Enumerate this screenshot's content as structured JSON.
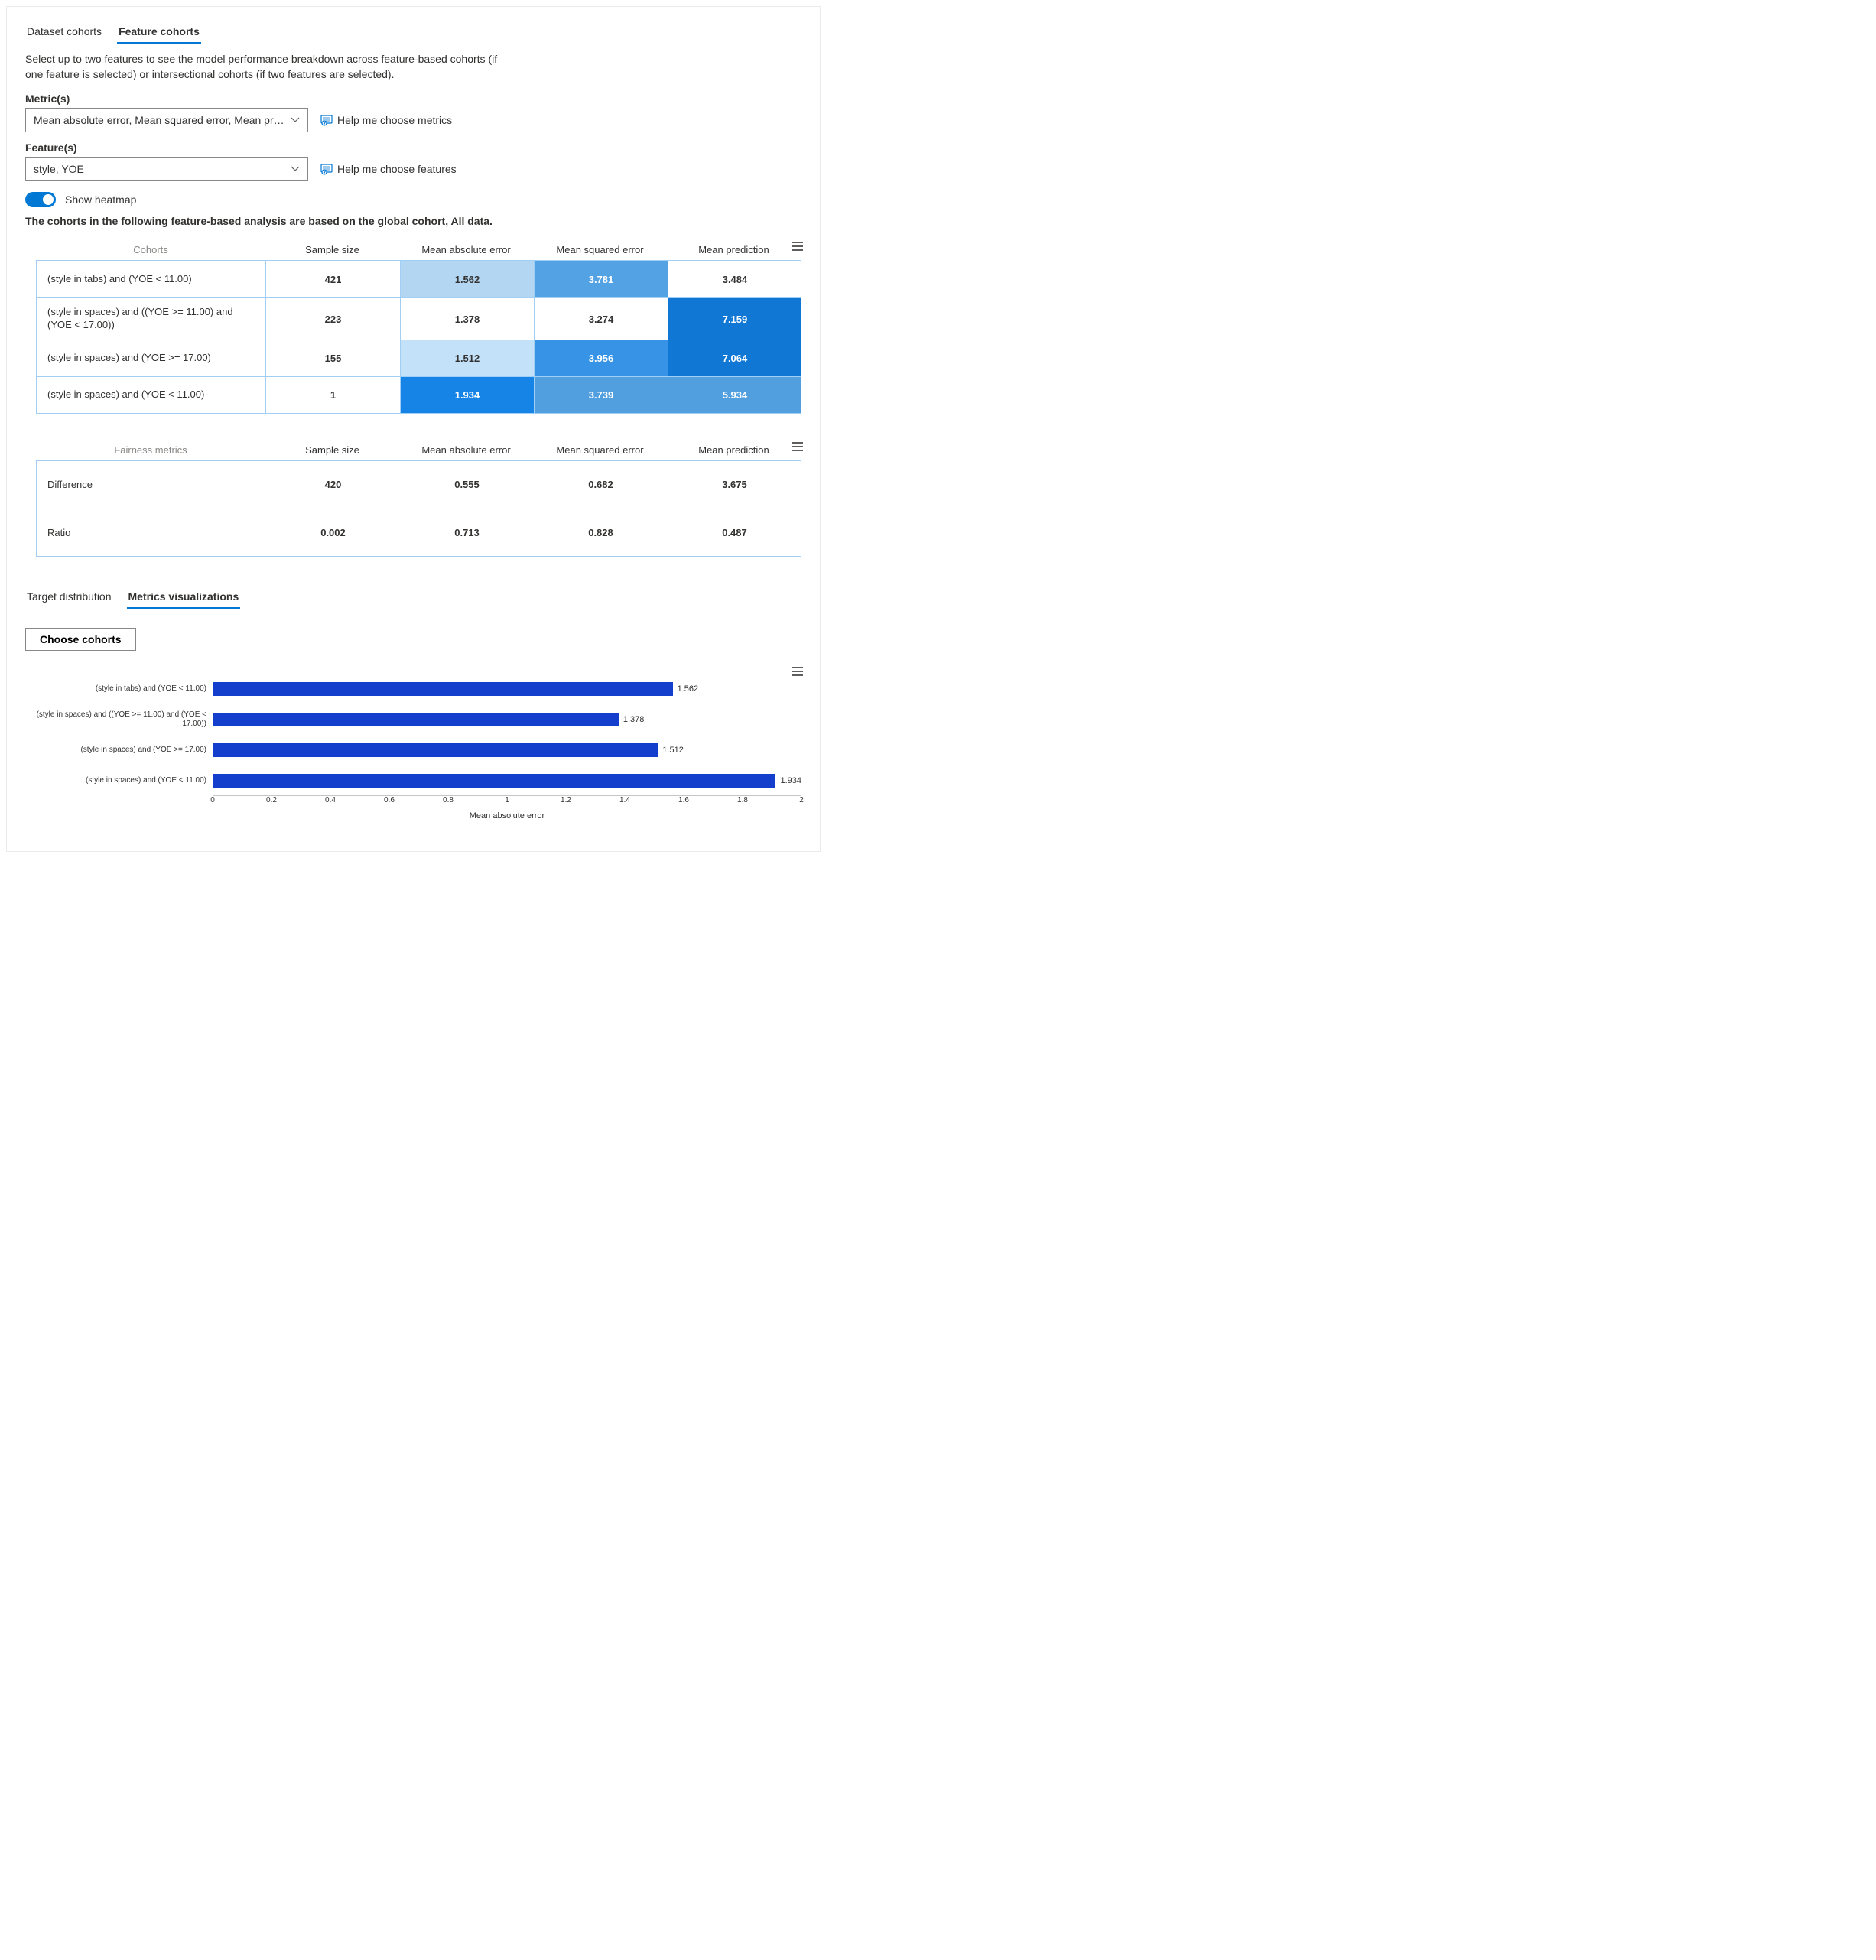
{
  "topTabs": [
    "Dataset cohorts",
    "Feature cohorts"
  ],
  "topTabActive": 1,
  "description": "Select up to two features to see the model performance breakdown across feature-based cohorts (if one feature is selected) or intersectional cohorts (if two features are selected).",
  "metrics": {
    "label": "Metric(s)",
    "value": "Mean absolute error, Mean squared error, Mean predicti...",
    "help": "Help me choose metrics"
  },
  "features": {
    "label": "Feature(s)",
    "value": "style, YOE",
    "help": "Help me choose features"
  },
  "toggle": {
    "label": "Show heatmap",
    "on": true
  },
  "note": "The cohorts in the following feature-based analysis are based on the global cohort, All data.",
  "cohortsTable": {
    "headers": {
      "label": "Cohorts",
      "cols": [
        "Sample size",
        "Mean absolute error",
        "Mean squared error",
        "Mean prediction"
      ]
    },
    "rows": [
      {
        "label": "(style in tabs) and (YOE < 11.00)",
        "cells": [
          {
            "v": "421",
            "shade": "shade-0"
          },
          {
            "v": "1.562",
            "shade": "shade-2"
          },
          {
            "v": "3.781",
            "shade": "shade-3"
          },
          {
            "v": "3.484",
            "shade": "shade-0"
          }
        ]
      },
      {
        "label": "(style in spaces) and ((YOE >= 11.00) and (YOE < 17.00))",
        "cells": [
          {
            "v": "223",
            "shade": "shade-0"
          },
          {
            "v": "1.378",
            "shade": "shade-0"
          },
          {
            "v": "3.274",
            "shade": "shade-0"
          },
          {
            "v": "7.159",
            "shade": "shade-6"
          }
        ]
      },
      {
        "label": "(style in spaces) and (YOE >= 17.00)",
        "cells": [
          {
            "v": "155",
            "shade": "shade-0"
          },
          {
            "v": "1.512",
            "shade": "shade-8"
          },
          {
            "v": "3.956",
            "shade": "shade-4"
          },
          {
            "v": "7.064",
            "shade": "shade-6"
          }
        ]
      },
      {
        "label": "(style in spaces) and (YOE < 11.00)",
        "cells": [
          {
            "v": "1",
            "shade": "shade-0"
          },
          {
            "v": "1.934",
            "shade": "shade-5"
          },
          {
            "v": "3.739",
            "shade": "shade-7"
          },
          {
            "v": "5.934",
            "shade": "shade-7"
          }
        ]
      }
    ]
  },
  "fairnessTable": {
    "headers": {
      "label": "Fairness metrics",
      "cols": [
        "Sample size",
        "Mean absolute error",
        "Mean squared error",
        "Mean prediction"
      ]
    },
    "rows": [
      {
        "label": "Difference",
        "cells": [
          "420",
          "0.555",
          "0.682",
          "3.675"
        ]
      },
      {
        "label": "Ratio",
        "cells": [
          "0.002",
          "0.713",
          "0.828",
          "0.487"
        ]
      }
    ]
  },
  "lowerTabs": [
    "Target distribution",
    "Metrics visualizations"
  ],
  "lowerTabActive": 1,
  "chooseCohorts": "Choose cohorts",
  "chart_data": {
    "type": "bar",
    "orientation": "horizontal",
    "categories": [
      "(style in tabs) and (YOE < 11.00)",
      "(style in spaces) and ((YOE >= 11.00) and (YOE < 17.00))",
      "(style in spaces) and (YOE >= 17.00)",
      "(style in spaces) and (YOE < 11.00)"
    ],
    "values": [
      1.562,
      1.378,
      1.512,
      1.934
    ],
    "xlabel": "Mean absolute error",
    "ylabel": "",
    "xlim": [
      0,
      2
    ],
    "xticks": [
      0,
      0.2,
      0.4,
      0.6,
      0.8,
      1,
      1.2,
      1.4,
      1.6,
      1.8,
      2
    ],
    "bar_color": "#143fcd"
  }
}
